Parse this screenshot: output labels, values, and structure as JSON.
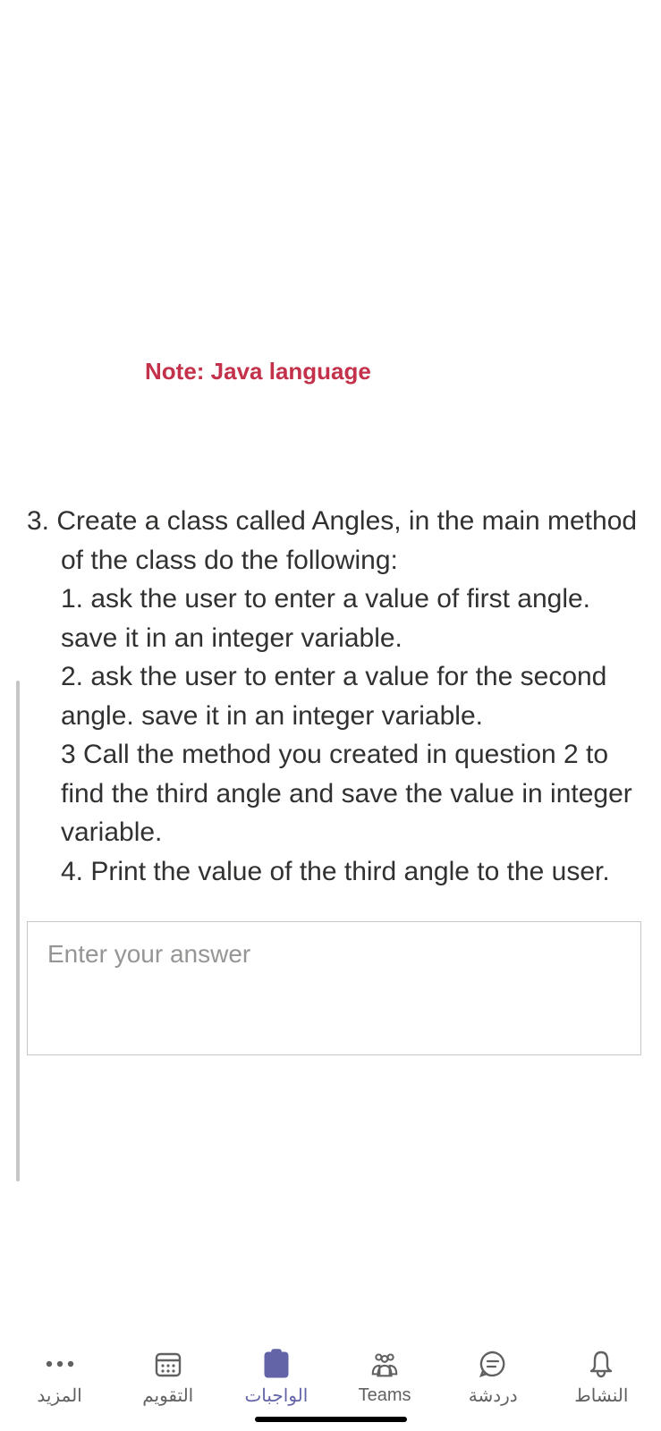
{
  "note": "Note: Java language",
  "question": {
    "number": "3.",
    "intro": "Create a class called Angles, in the main method of the class do the following:",
    "steps": [
      "1. ask the user to enter a value of first angle. save it in an integer variable.",
      "2. ask the user to enter a value for the second angle. save it in an integer variable.",
      "3 Call the method you created in question 2 to find the third angle and save the value in integer variable.",
      "4. Print the value of the third angle to the user."
    ]
  },
  "answer": {
    "placeholder": "Enter your answer",
    "value": ""
  },
  "tabs": {
    "activity": "النشاط",
    "chat": "دردشة",
    "teams": "Teams",
    "assignments": "الواجبات",
    "calendar": "التقويم",
    "more": "المزيد"
  }
}
